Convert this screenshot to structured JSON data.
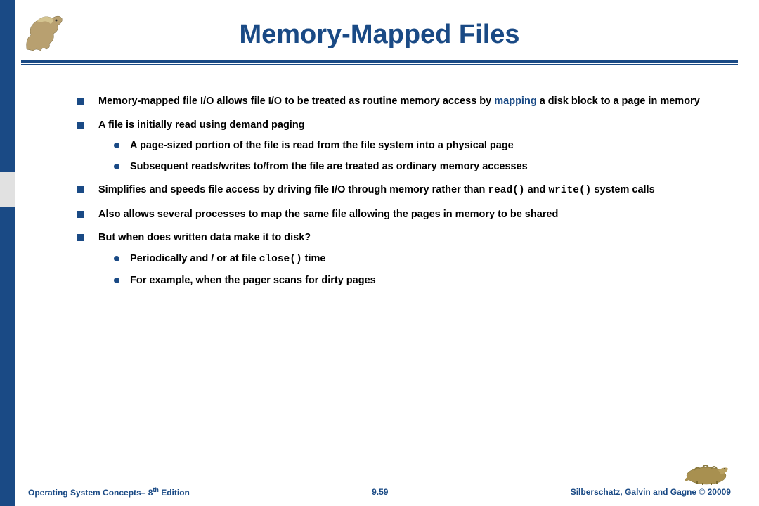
{
  "title": "Memory-Mapped Files",
  "bullets": {
    "b1_pre": "Memory-mapped file I/O allows file I/O to be treated as routine memory access by ",
    "b1_map": "mapping",
    "b1_post": " a disk block to a page in memory",
    "b2": "A file is initially read using demand paging",
    "b2a": "A page-sized portion of the file is read from the file system into a physical page",
    "b2b": "Subsequent reads/writes to/from the file are treated as ordinary memory accesses",
    "b3_pre": "Simplifies and speeds file access by driving file I/O through memory rather than ",
    "b3_code1": "read()",
    "b3_mid": " and ",
    "b3_code2": "write()",
    "b3_post": " system calls",
    "b4": "Also allows several processes to map the same file allowing the pages in memory to be shared",
    "b5": "But when does written data make it to disk?",
    "b5a_pre": "Periodically and / or at file ",
    "b5a_code": "close()",
    "b5a_post": " time",
    "b5b": "For example, when the pager scans for dirty pages"
  },
  "footer": {
    "left_pre": "Operating System Concepts– 8",
    "left_sup": "th",
    "left_post": " Edition",
    "center": "9.59",
    "right": "Silberschatz, Galvin and Gagne © 20009"
  }
}
